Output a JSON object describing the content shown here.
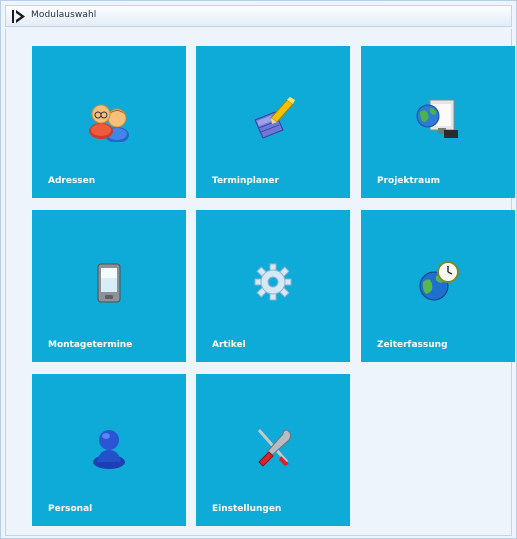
{
  "window": {
    "title": "Modulauswahl"
  },
  "tiles": [
    {
      "label": "Adressen",
      "icon": "contacts-icon"
    },
    {
      "label": "Terminplaner",
      "icon": "planner-icon"
    },
    {
      "label": "Projektraum",
      "icon": "project-room-icon"
    },
    {
      "label": "Montagetermine",
      "icon": "mobile-device-icon"
    },
    {
      "label": "Artikel",
      "icon": "gear-icon"
    },
    {
      "label": "Zeiterfassung",
      "icon": "globe-clock-icon"
    },
    {
      "label": "Personal",
      "icon": "person-icon"
    },
    {
      "label": "Einstellungen",
      "icon": "tools-icon"
    }
  ],
  "colors": {
    "tile_background": "#0eabd9",
    "window_background": "#eef4fb"
  }
}
